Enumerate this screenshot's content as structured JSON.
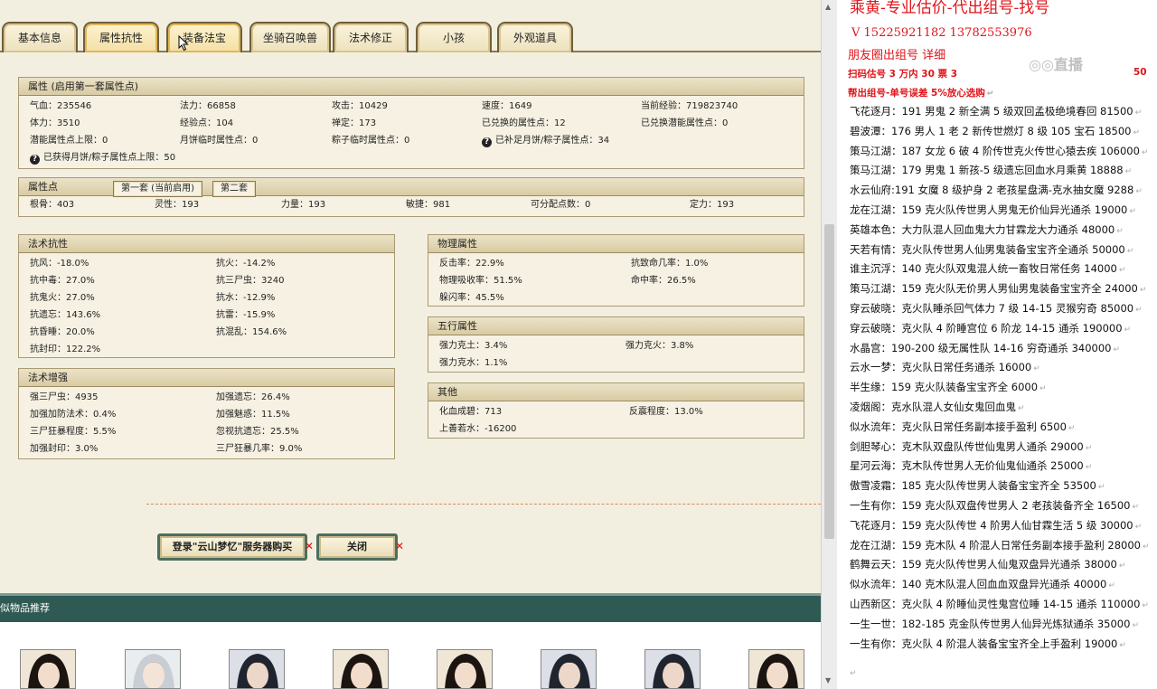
{
  "tabs": [
    {
      "label": "基本信息"
    },
    {
      "label": "属性抗性"
    },
    {
      "label": "装备法宝"
    },
    {
      "label": "坐骑召唤兽"
    },
    {
      "label": "法术修正"
    },
    {
      "label": "小孩"
    },
    {
      "label": "外观道具"
    }
  ],
  "attributes": {
    "title": "属性 (启用第一套属性点)",
    "row1": [
      "气血：235546",
      "法力：66858",
      "攻击：10429",
      "速度：1649",
      "当前经验：719823740"
    ],
    "row2": [
      "体力：3510",
      "经验点：104",
      "禅定：173",
      "已兑换的属性点：12",
      "已兑换潜能属性点：0"
    ],
    "row3": [
      "潜能属性点上限：0",
      "月饼临时属性点：0",
      "粽子临时属性点：0",
      "已补足月饼/粽子属性点：34"
    ],
    "row4": [
      "已获得月饼/粽子属性点上限：50"
    ]
  },
  "points": {
    "title": "属性点",
    "tab1": "第一套 (当前启用)",
    "tab2": "第二套",
    "row": [
      "根骨：403",
      "灵性：193",
      "力量：193",
      "敏捷：981",
      "可分配点数：0",
      "定力：193"
    ]
  },
  "magic_resist": {
    "title": "法术抗性",
    "left": [
      "抗风：-18.0%",
      "抗中毒：27.0%",
      "抗鬼火：27.0%",
      "抗遗忘：143.6%",
      "抗昏睡：20.0%",
      "抗封印：122.2%"
    ],
    "right": [
      "抗火：-14.2%",
      "抗三尸虫：3240",
      "抗水：-12.9%",
      "抗雷：-15.9%",
      "抗混乱：154.6%",
      ""
    ]
  },
  "magic_boost": {
    "title": "法术增强",
    "left": [
      "强三尸虫：4935",
      "加强加防法术：0.4%",
      "三尸狂暴程度：5.5%",
      "加强封印：3.0%"
    ],
    "right": [
      "加强遗忘：26.4%",
      "加强魅惑：11.5%",
      "忽视抗遗忘：25.5%",
      "三尸狂暴几率：9.0%"
    ]
  },
  "physical": {
    "title": "物理属性",
    "left": [
      "反击率：22.9%",
      "物理吸收率：51.5%",
      "躲闪率：45.5%"
    ],
    "right": [
      "抗致命几率：1.0%",
      "命中率：26.5%",
      ""
    ]
  },
  "five_elements": {
    "title": "五行属性",
    "left": [
      "强力克土：3.4%",
      "强力克水：1.1%"
    ],
    "right": [
      "强力克火：3.8%",
      ""
    ]
  },
  "other": {
    "title": "其他",
    "left": [
      "化血成碧：713",
      "上善若水：-16200"
    ],
    "right": [
      "反震程度：13.0%",
      ""
    ]
  },
  "buttons": {
    "login": "登录\"云山梦忆\"服务器购买",
    "close": "关闭",
    "x": "✕"
  },
  "recommend": {
    "label": "似物品推荐"
  },
  "right_doc": {
    "title": "乘黄-专业估价-代出组号-找号",
    "phones": "V 15225921182   13782553976",
    "line2": "朋友圈出组号   详细",
    "line3a": "扫码估号 3 万内 30 票 3",
    "line3b": "50",
    "line4": "帮出组号-单号误差 5%放心选购",
    "watermark": "◎◎直播",
    "mark": "↵",
    "items": [
      "飞花逐月：191 男鬼 2 新全满 5 级双回孟极绝境春回 81500",
      "碧波潭：176 男人 1 老 2 新传世燃灯 8 级 105 宝石 18500",
      "策马江湖：187 女龙 6 破 4 阶传世克火传世心猿去疾 106000",
      "策马江湖：179 男鬼 1 新孩-5 级遗忘回血水月乘黄 18888",
      "水云仙府:191 女魔 8 级护身 2 老孩星盘满-克水抽女魔 9288",
      "龙在江湖：159 克火队传世男人男鬼无价仙异光通杀 19000",
      "英雄本色：大力队混人回血鬼大力甘霖龙大力通杀 48000",
      "天若有情：克火队传世男人仙男鬼装备宝宝齐全通杀 50000",
      "谁主沉浮：140 克火队双鬼混人统一畜牧日常任务 14000",
      "策马江湖：159 克火队无价男人男仙男鬼装备宝宝齐全 24000",
      "穿云破晓：克火队睡杀回气体力 7 级 14-15 灵猴穷奇 85000",
      "穿云破晓：克火队 4 阶睡宫位 6 阶龙 14-15 通杀 190000",
      "水晶宫：190-200 级无属性队 14-16 穷奇通杀 340000",
      "云水一梦：克火队日常任务通杀 16000",
      "半生缘：159 克火队装备宝宝齐全 6000",
      "凌烟阁：克水队混人女仙女鬼回血鬼",
      "似水流年：克火队日常任务副本接手盈利 6500",
      "剑胆琴心：克木队双盘队传世仙鬼男人通杀 29000",
      "星河云海：克木队传世男人无价仙鬼仙通杀 25000",
      "傲雪凌霜：185 克火队传世男人装备宝宝齐全 53500",
      "一生有你：159 克火队双盘传世男人 2 老孩装备齐全 16500",
      "飞花逐月：159 克火队传世 4 阶男人仙甘霖生活 5 级 30000",
      "龙在江湖：159 克木队 4 阶混人日常任务副本接手盈利 28000",
      "鹤舞云天：159 克火队传世男人仙鬼双盘异光通杀 38000",
      "似水流年：140 克木队混人回血血双盘异光通杀 40000",
      "山西新区：克火队 4 阶睡仙灵性鬼宫位睡 14-15 通杀 110000",
      "一生一世：182-185 克金队传世男人仙异光炼狱通杀 35000",
      "一生有你：克火队 4 阶混人装备宝宝齐全上手盈利 19000"
    ]
  }
}
